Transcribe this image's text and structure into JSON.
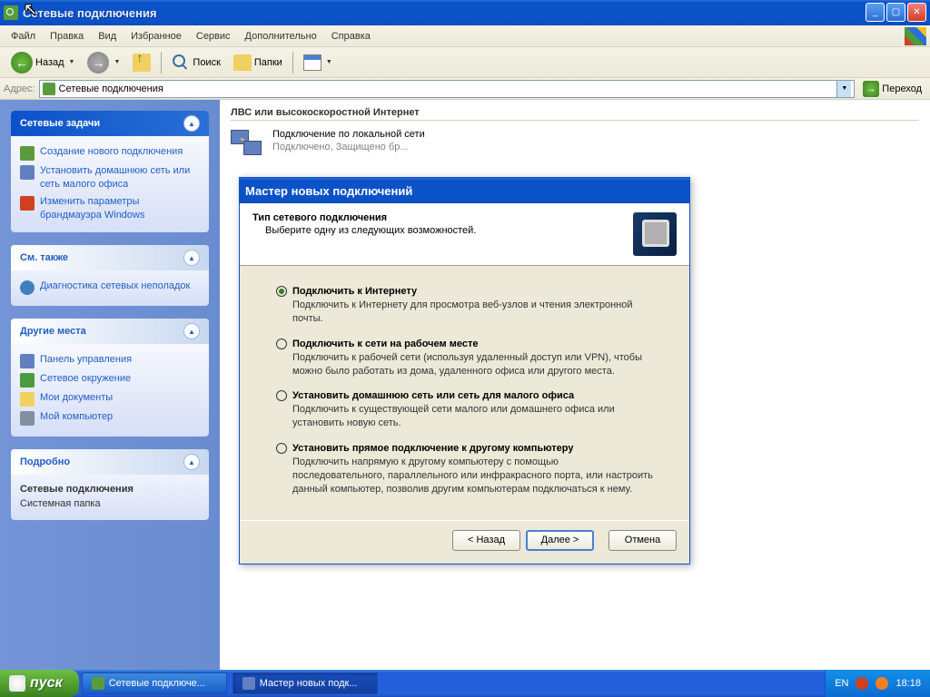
{
  "window": {
    "title": "Сетевые подключения"
  },
  "menubar": {
    "file": "Файл",
    "edit": "Правка",
    "view": "Вид",
    "favorites": "Избранное",
    "tools": "Сервис",
    "extra": "Дополнительно",
    "help": "Справка"
  },
  "toolbar": {
    "back": "Назад",
    "search": "Поиск",
    "folders": "Папки"
  },
  "addressbar": {
    "label": "Адрес:",
    "value": "Сетевые подключения",
    "go": "Переход"
  },
  "sidepanel": {
    "tasks": {
      "title": "Сетевые задачи",
      "items": {
        "create": "Создание нового подключения",
        "home": "Установить домашнюю сеть или сеть малого офиса",
        "firewall": "Изменить параметры брандмауэра Windows"
      }
    },
    "seealso": {
      "title": "См. также",
      "items": {
        "diag": "Диагностика сетевых неполадок"
      }
    },
    "places": {
      "title": "Другие места",
      "items": {
        "cp": "Панель управления",
        "netenv": "Сетевое окружение",
        "docs": "Мои документы",
        "mycomp": "Мой компьютер"
      }
    },
    "details": {
      "title": "Подробно",
      "name": "Сетевые подключения",
      "type": "Системная папка"
    }
  },
  "content": {
    "section": "ЛВС или высокоскоростной Интернет",
    "connection": {
      "name": "Подключение по локальной сети",
      "status": "Подключено, Защищено бр..."
    }
  },
  "wizard": {
    "title": "Мастер новых подключений",
    "header": {
      "title": "Тип сетевого подключения",
      "subtitle": "Выберите одну из следующих возможностей."
    },
    "options": {
      "internet": {
        "label": "Подключить к Интернету",
        "desc": "Подключить к Интернету для просмотра веб-узлов и чтения электронной почты."
      },
      "work": {
        "label": "Подключить к сети на рабочем месте",
        "desc": "Подключить к рабочей сети (используя удаленный доступ или VPN), чтобы можно было работать из дома, удаленного офиса или другого места."
      },
      "home": {
        "label": "Установить домашнюю сеть или сеть для малого офиса",
        "desc": "Подключить к существующей сети малого или домашнего офиса или установить новую сеть."
      },
      "direct": {
        "label": "Установить прямое подключение к другому компьютеру",
        "desc": "Подключить напрямую к другому компьютеру с помощью последовательного, параллельного или инфракрасного порта, или настроить данный компьютер, позволив другим компьютерам подключаться к нему."
      }
    },
    "buttons": {
      "back": "< Назад",
      "next": "Далее >",
      "cancel": "Отмена"
    }
  },
  "taskbar": {
    "start": "пуск",
    "tasks": {
      "netconn": "Сетевые подключе...",
      "wizard": "Мастер новых подк..."
    },
    "systray": {
      "lang": "EN",
      "time": "18:18"
    }
  }
}
